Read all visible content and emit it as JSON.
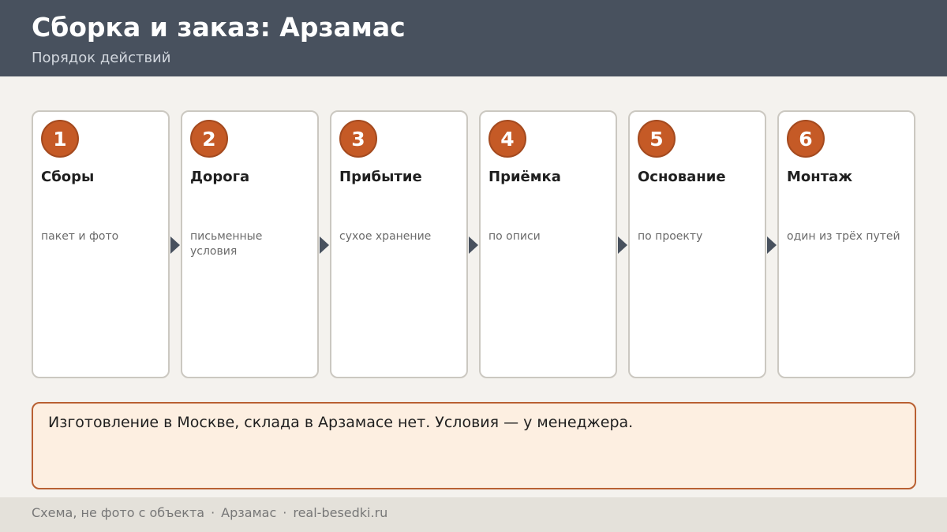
{
  "header": {
    "title": "Сборка и заказ: Арзамас",
    "subtitle": "Порядок действий"
  },
  "steps": [
    {
      "number": "1",
      "title": "Сборы",
      "description": "пакет и фото"
    },
    {
      "number": "2",
      "title": "Дорога",
      "description": "письменные условия"
    },
    {
      "number": "3",
      "title": "Прибытие",
      "description": "сухое хранение"
    },
    {
      "number": "4",
      "title": "Приёмка",
      "description": "по описи"
    },
    {
      "number": "5",
      "title": "Основание",
      "description": "по проекту"
    },
    {
      "number": "6",
      "title": "Монтаж",
      "description": "один из трёх путей"
    }
  ],
  "note": {
    "text": "Изготовление в Москве, склада в Арзамасе нет. Условия — у менеджера."
  },
  "footer": {
    "items": [
      "Схема, не фото с объекта",
      "Арзамас",
      "real-besedki.ru"
    ],
    "separator": "·"
  }
}
